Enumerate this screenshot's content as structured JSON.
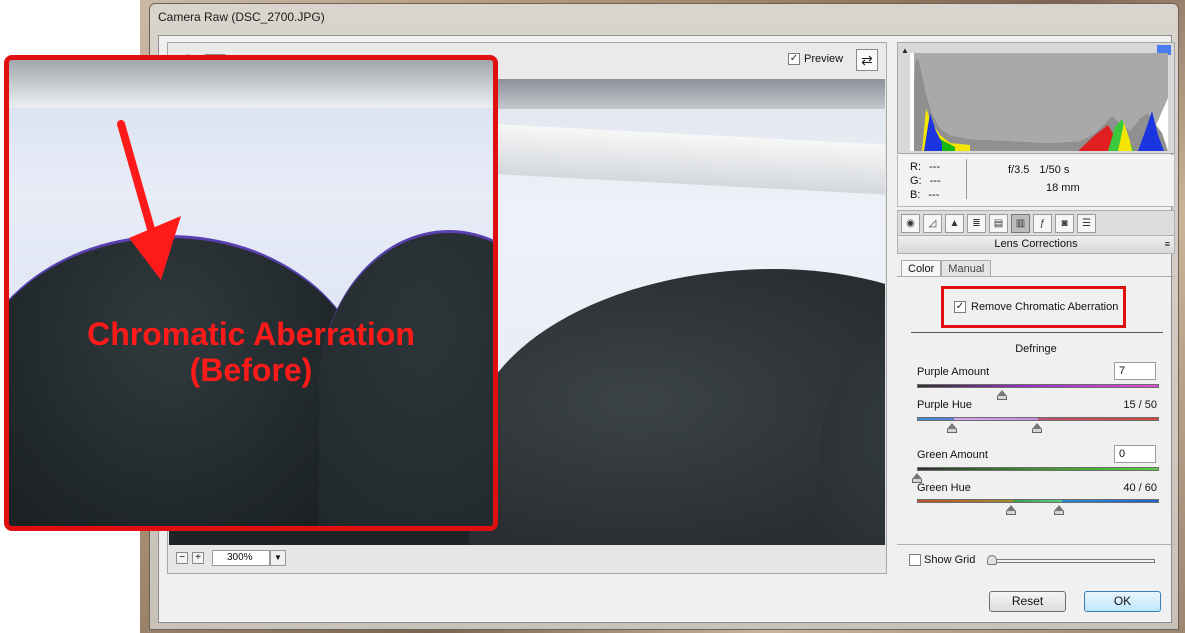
{
  "window": {
    "title": "Camera Raw (DSC_2700.JPG)"
  },
  "toolbar": {
    "tools": [
      "zoom-icon",
      "hand-icon",
      "white-balance-icon",
      "color-sampler-icon",
      "target-adjust-icon",
      "crop-icon",
      "straighten-icon",
      "spot-removal-icon",
      "red-eye-icon",
      "adjustment-brush-icon",
      "graduated-filter-icon"
    ],
    "preview_label": "Preview",
    "preview_checked": true
  },
  "zoom": {
    "minus": "−",
    "plus": "+",
    "value": "300%",
    "dropdown": "▼"
  },
  "annotation": {
    "line1": "Chromatic Aberration",
    "line2": "(Before)",
    "color": "#ff1a1a"
  },
  "readout": {
    "r_label": "R:",
    "r_value": "---",
    "g_label": "G:",
    "g_value": "---",
    "b_label": "B:",
    "b_value": "---",
    "aperture": "f/3.5",
    "shutter": "1/50 s",
    "focal": "18 mm"
  },
  "panel": {
    "tabs": [
      "basic-icon",
      "tone-curve-icon",
      "detail-icon",
      "hsl-icon",
      "split-toning-icon",
      "lens-corrections-icon",
      "effects-icon",
      "camera-calibration-icon",
      "presets-icon"
    ],
    "active_tab": 5,
    "title": "Lens Corrections",
    "menu": "≡"
  },
  "subtabs": {
    "color": "Color",
    "manual": "Manual"
  },
  "chromatic": {
    "label": "Remove Chromatic Aberration",
    "checked": true
  },
  "defringe": {
    "heading": "Defringe",
    "purple_amount_label": "Purple Amount",
    "purple_amount_value": "7",
    "purple_amount_level": 0.35,
    "purple_hue_label": "Purple Hue",
    "purple_hue_value": "15 / 50",
    "green_amount_label": "Green Amount",
    "green_amount_value": "0",
    "green_amount_level": 0.0,
    "green_hue_label": "Green Hue",
    "green_hue_value": "40 / 60"
  },
  "grid": {
    "label": "Show Grid",
    "checked": false
  },
  "buttons": {
    "reset": "Reset",
    "ok": "OK"
  },
  "colors": {
    "accent_red": "#e01010",
    "histogram_blue": "#1b35e0"
  }
}
